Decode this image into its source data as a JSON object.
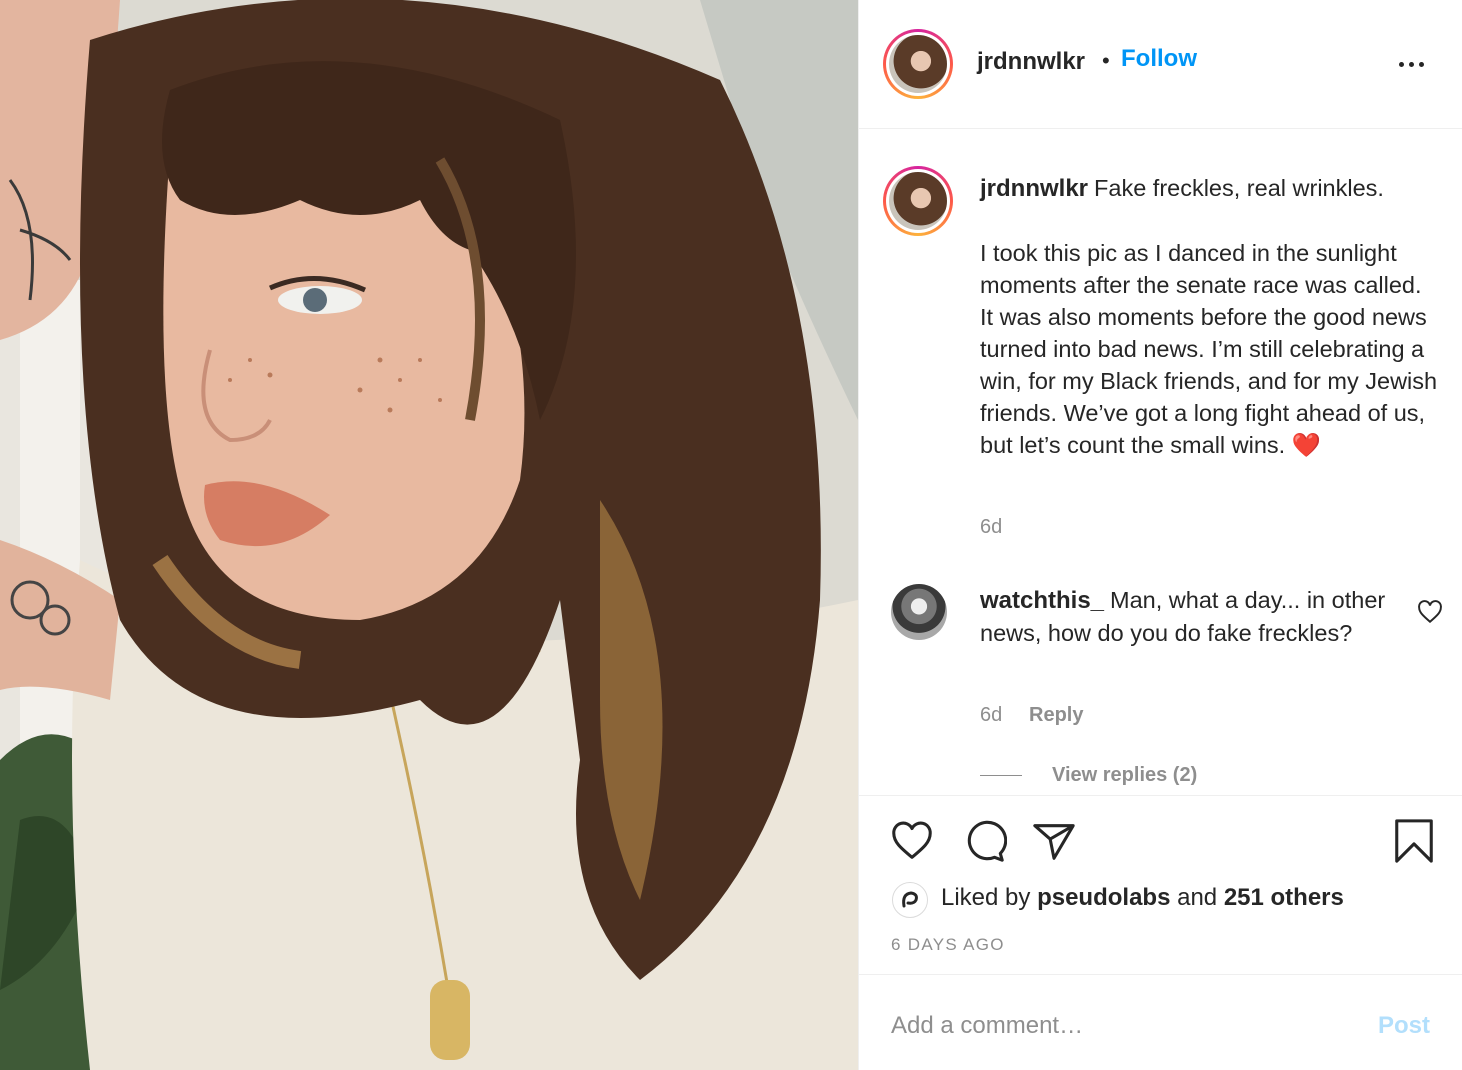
{
  "post": {
    "photo_icon": "portrait-photo",
    "username": "jrdnnwlkr",
    "separator": "•",
    "follow_label": "Follow",
    "more_icon": "more-horizontal-icon"
  },
  "caption": {
    "username": "jrdnnwlkr",
    "line1": "Fake freckles, real wrinkles.",
    "body": "I took this pic as I danced in the sunlight moments after the senate race was called. It was also moments before the good news turned into bad news. I’m still celebrating a win, for my Black friends, and for my Jewish friends. We’ve got a long fight ahead of us, but let’s count the small wins.",
    "emoji": "❤️",
    "time": "6d"
  },
  "comment": {
    "username": "watchthis_",
    "text": "Man, what a day... in other news, how do you do fake freckles?",
    "time": "6d",
    "reply_label": "Reply",
    "view_replies": "View replies (2)"
  },
  "actions": {
    "like_icon": "heart-icon",
    "comment_icon": "comment-bubble-icon",
    "share_icon": "paper-plane-icon",
    "save_icon": "bookmark-icon"
  },
  "likes": {
    "prefix": "Liked by",
    "user": "pseudolabs",
    "middle": "and",
    "others": "251 others"
  },
  "date": "6 DAYS AGO",
  "add_comment": {
    "placeholder": "Add a comment…",
    "post_label": "Post"
  },
  "colors": {
    "link_blue": "#0095f6",
    "post_disabled": "#b2dffc",
    "text": "#262626",
    "muted": "#8e8e8e"
  }
}
